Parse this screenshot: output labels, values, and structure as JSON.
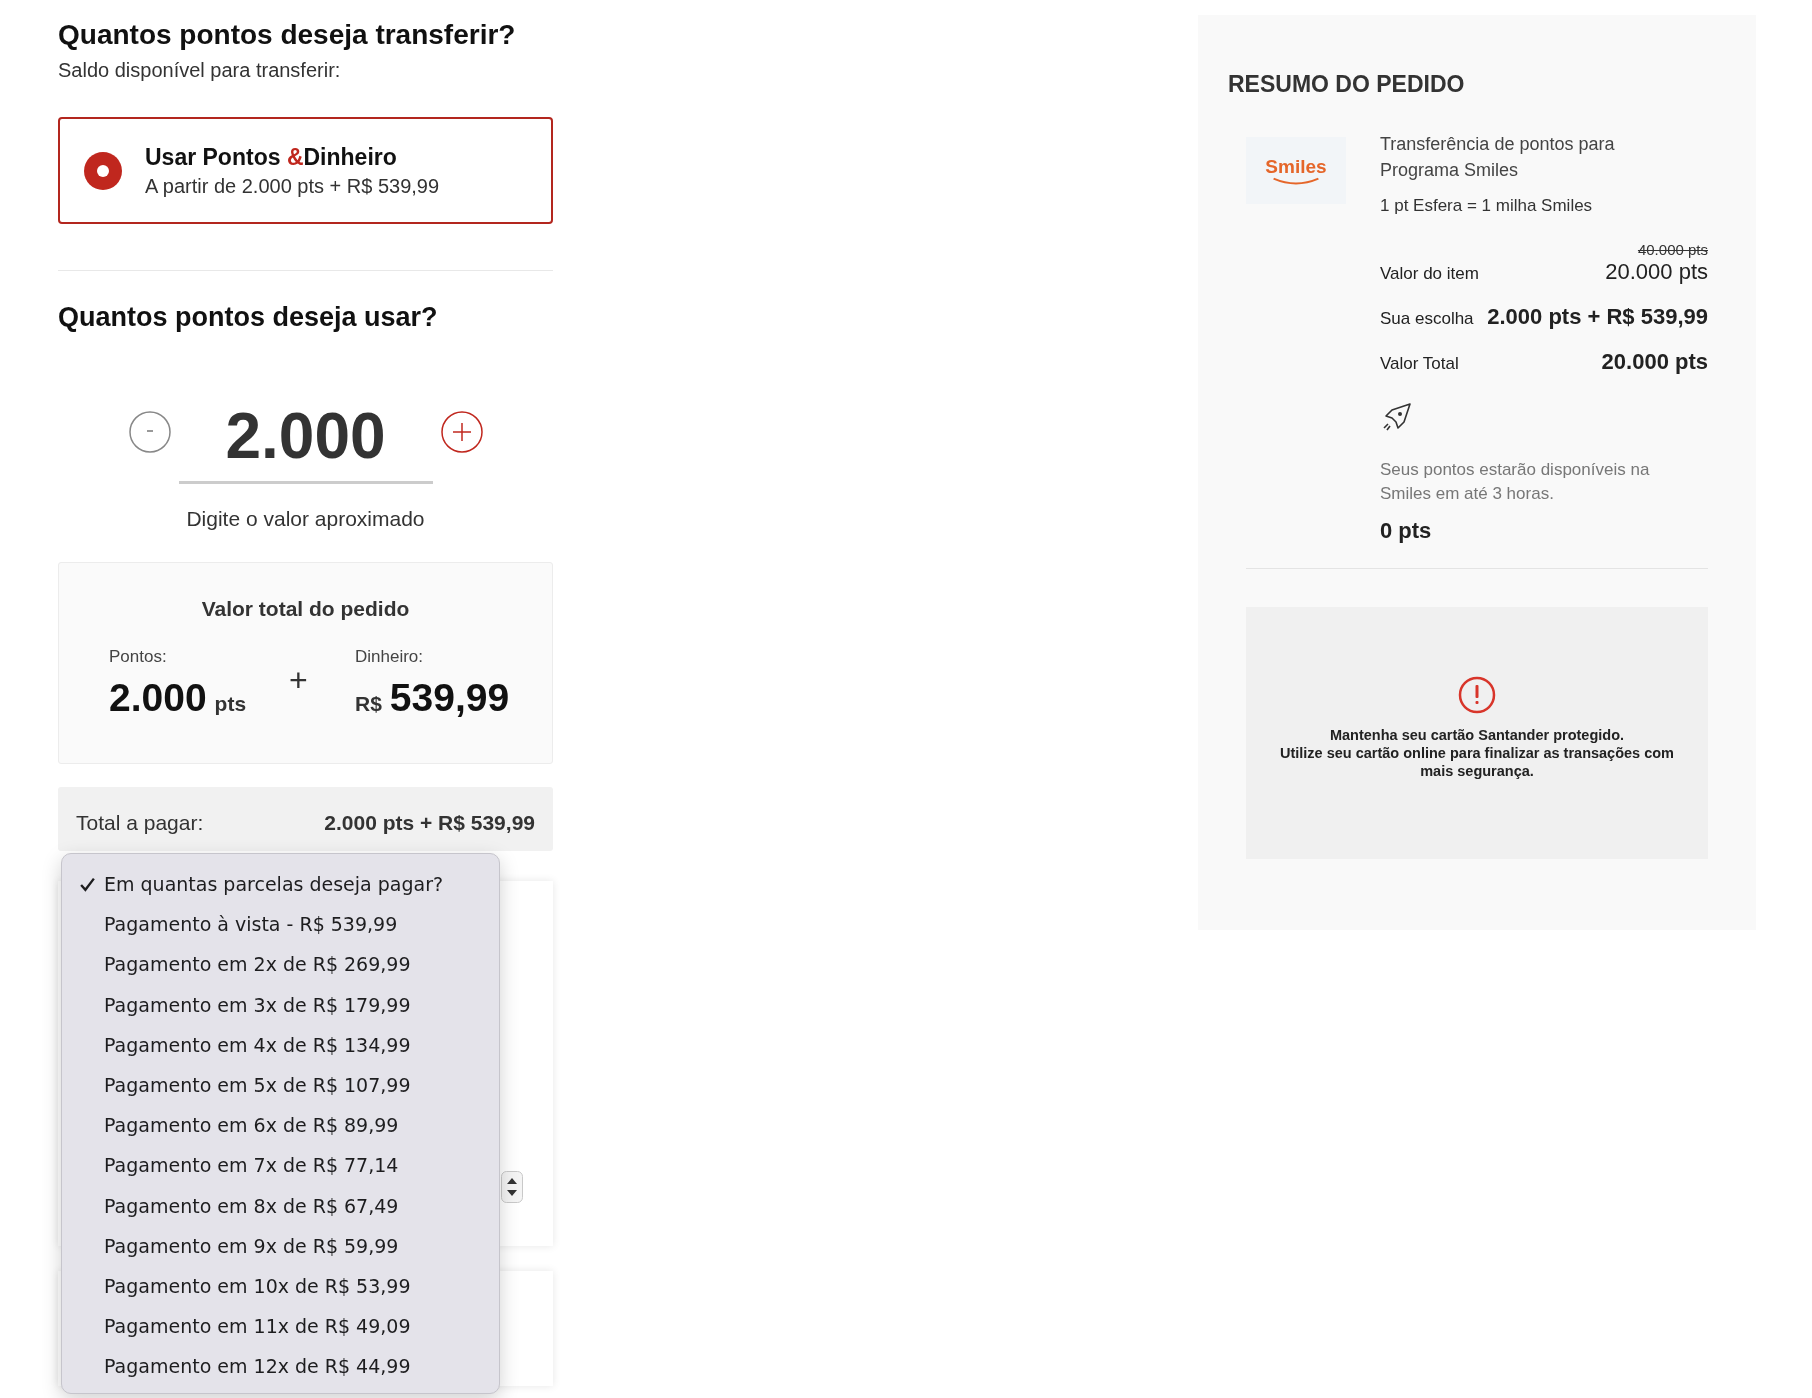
{
  "transfer": {
    "title": "Quantos pontos deseja transferir?",
    "balance_label": "Saldo disponível para transferir:",
    "option": {
      "selected": true,
      "title_start": "Usar Pontos ",
      "title_accent": "&",
      "title_end": "Dinheiro",
      "subtitle": "A partir de 2.000 pts + R$ 539,99"
    }
  },
  "usage": {
    "title": "Quantos pontos deseja usar?",
    "value": "2.000",
    "hint": "Digite o valor aproximado"
  },
  "order_total": {
    "title": "Valor total do pedido",
    "points_label": "Pontos:",
    "points_value": "2.000",
    "points_unit": "pts",
    "plus": "+",
    "money_label": "Dinheiro:",
    "currency": "R$",
    "money_value": "539,99"
  },
  "to_pay": {
    "label": "Total a pagar:",
    "value": "2.000 pts + R$ 539,99"
  },
  "installments_menu": [
    {
      "label": "Em quantas parcelas deseja pagar?",
      "selected": true
    },
    {
      "label": "Pagamento à vista - R$ 539,99",
      "selected": false
    },
    {
      "label": "Pagamento em 2x de R$ 269,99",
      "selected": false
    },
    {
      "label": "Pagamento em 3x de R$ 179,99",
      "selected": false
    },
    {
      "label": "Pagamento em 4x de R$ 134,99",
      "selected": false
    },
    {
      "label": "Pagamento em 5x de R$ 107,99",
      "selected": false
    },
    {
      "label": "Pagamento em 6x de R$ 89,99",
      "selected": false
    },
    {
      "label": "Pagamento em 7x de R$ 77,14",
      "selected": false
    },
    {
      "label": "Pagamento em 8x de R$ 67,49",
      "selected": false
    },
    {
      "label": "Pagamento em 9x de R$ 59,99",
      "selected": false
    },
    {
      "label": "Pagamento em 10x de R$ 53,99",
      "selected": false
    },
    {
      "label": "Pagamento em 11x de R$ 49,09",
      "selected": false
    },
    {
      "label": "Pagamento em 12x de R$ 44,99",
      "selected": false
    }
  ],
  "summary": {
    "title": "RESUMO DO PEDIDO",
    "logo_text": "Smiles",
    "description": "Transferência de pontos para Programa Smiles",
    "rate": "1 pt Esfera = 1 milha Smiles",
    "old_price": "40.000 pts",
    "rows": [
      {
        "label": "Valor do item",
        "value": "20.000 pts",
        "bold": false
      },
      {
        "label": "Sua escolha",
        "value": "2.000 pts + R$ 539,99",
        "bold": true
      },
      {
        "label": "Valor Total",
        "value": "20.000 pts",
        "bold": true
      }
    ],
    "delivery_note": "Seus pontos estarão disponíveis na Smiles em até 3 horas.",
    "points": "0 pts",
    "alert": [
      "Mantenha seu cartão Santander protegido.",
      "Utilize seu cartão online para finalizar as transações com mais segurança."
    ]
  }
}
